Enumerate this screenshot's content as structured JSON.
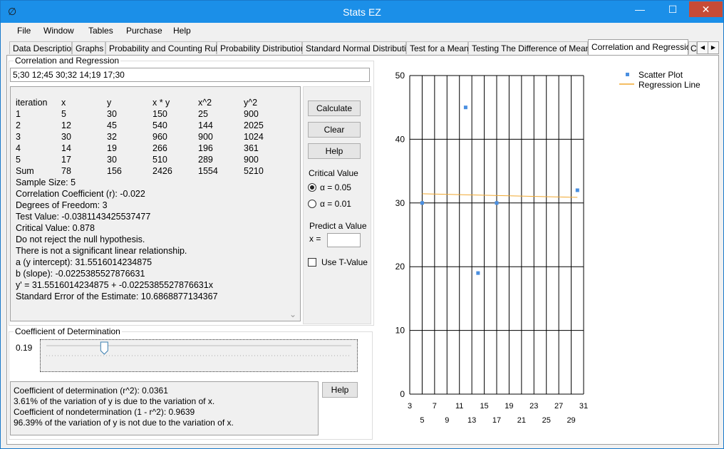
{
  "window": {
    "title": "Stats EZ",
    "minimize_glyph": "—",
    "maximize_glyph": "☐",
    "close_glyph": "✕",
    "app_icon_glyph": "∅"
  },
  "menu": [
    "File",
    "Window",
    "Tables",
    "Purchase",
    "Help"
  ],
  "tabs": [
    "Data Description",
    "Graphs",
    "Probability and Counting Rules",
    "Probability Distributions",
    "Standard Normal Distribution",
    "Test for a Mean",
    "Testing The Difference of Means",
    "Correlation and Regression",
    "C"
  ],
  "tab_scroll": {
    "left": "◀",
    "right": "▶"
  },
  "corr": {
    "group_label": "Correlation and Regression",
    "input_value": "5;30 12;45 30;32 14;19 17;30",
    "table_headers": [
      "iteration",
      "x",
      "y",
      "x * y",
      "x^2",
      "y^2"
    ],
    "table_rows": [
      [
        "1",
        "5",
        "30",
        "150",
        "25",
        "900"
      ],
      [
        "2",
        "12",
        "45",
        "540",
        "144",
        "2025"
      ],
      [
        "3",
        "30",
        "32",
        "960",
        "900",
        "1024"
      ],
      [
        "4",
        "14",
        "19",
        "266",
        "196",
        "361"
      ],
      [
        "5",
        "17",
        "30",
        "510",
        "289",
        "900"
      ],
      [
        "Sum",
        "78",
        "156",
        "2426",
        "1554",
        "5210"
      ]
    ],
    "result_lines": [
      "Sample Size: 5",
      "Correlation Coefficient (r): -0.022",
      "Degrees of Freedom: 3",
      "Test Value: -0.0381143425537477",
      "Critical Value: 0.878",
      "Do not reject the null hypothesis.",
      "There is not a significant linear relationship.",
      "a (y intercept): 31.5516014234875",
      "b (slope): -0.0225385527876631",
      "y' = 31.5516014234875 + -0.0225385527876631x",
      " Standard Error of the Estimate: 10.6868877134367"
    ],
    "buttons": {
      "calculate": "Calculate",
      "clear": "Clear",
      "help": "Help"
    },
    "critical_value_label": "Critical Value",
    "alpha_005": "α = 0.05",
    "alpha_001": "α = 0.01",
    "predict_label": "Predict a Value",
    "x_label": "x =",
    "predict_value": "",
    "use_t_value": "Use T-Value",
    "scroll_down_glyph": "⌄"
  },
  "cod": {
    "group_label": "Coefficient of Determination",
    "slider_value_label": "0.19",
    "slider_level": 0.19,
    "lines": [
      "Coefficient of determination (r^2): 0.0361",
      "3.61% of the variation of y is due to the variation of x.",
      "Coefficient of nondetermination (1 - r^2): 0.9639",
      "96.39% of the variation of y is not due to the variation of x."
    ],
    "help": "Help"
  },
  "chart_data": {
    "type": "scatter",
    "title": "",
    "xlabel": "",
    "ylabel": "",
    "xlim": [
      3,
      31
    ],
    "ylim": [
      0,
      50
    ],
    "x_ticks_upper": [
      "3",
      "7",
      "11",
      "15",
      "19",
      "23",
      "27",
      "31"
    ],
    "x_ticks_lower": [
      "5",
      "9",
      "13",
      "17",
      "21",
      "25",
      "29"
    ],
    "x_tick_values_upper": [
      3,
      7,
      11,
      15,
      19,
      23,
      27,
      31
    ],
    "x_tick_values_lower": [
      5,
      9,
      13,
      17,
      21,
      25,
      29
    ],
    "y_ticks": [
      "0",
      "10",
      "20",
      "30",
      "40",
      "50"
    ],
    "y_tick_values": [
      0,
      10,
      20,
      30,
      40,
      50
    ],
    "grid": true,
    "legend_position": "top-right",
    "series": [
      {
        "name": "Scatter Plot",
        "color": "#4a8fe0",
        "points": [
          [
            5,
            30
          ],
          [
            12,
            45
          ],
          [
            30,
            32
          ],
          [
            14,
            19
          ],
          [
            17,
            30
          ]
        ]
      },
      {
        "name": "Regression Line",
        "color": "#f0a830",
        "points": [
          [
            5,
            31.44
          ],
          [
            30,
            30.88
          ]
        ]
      }
    ]
  }
}
